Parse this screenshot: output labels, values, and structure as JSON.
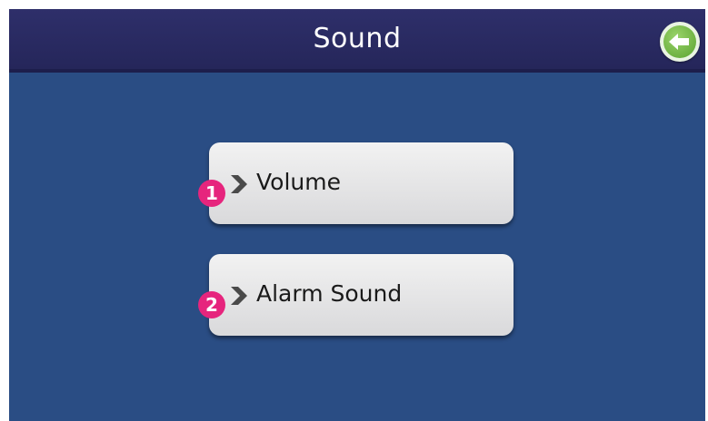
{
  "header": {
    "title": "Sound",
    "back_icon": "back-arrow-icon",
    "back_color": "#6cb43f"
  },
  "menu": {
    "items": [
      {
        "number": "1",
        "label": "Volume"
      },
      {
        "number": "2",
        "label": "Alarm Sound"
      }
    ]
  },
  "colors": {
    "background": "#2a4d84",
    "header": "#2e2f6a",
    "button": "#e4e4e6",
    "badge": "#e6257d"
  }
}
